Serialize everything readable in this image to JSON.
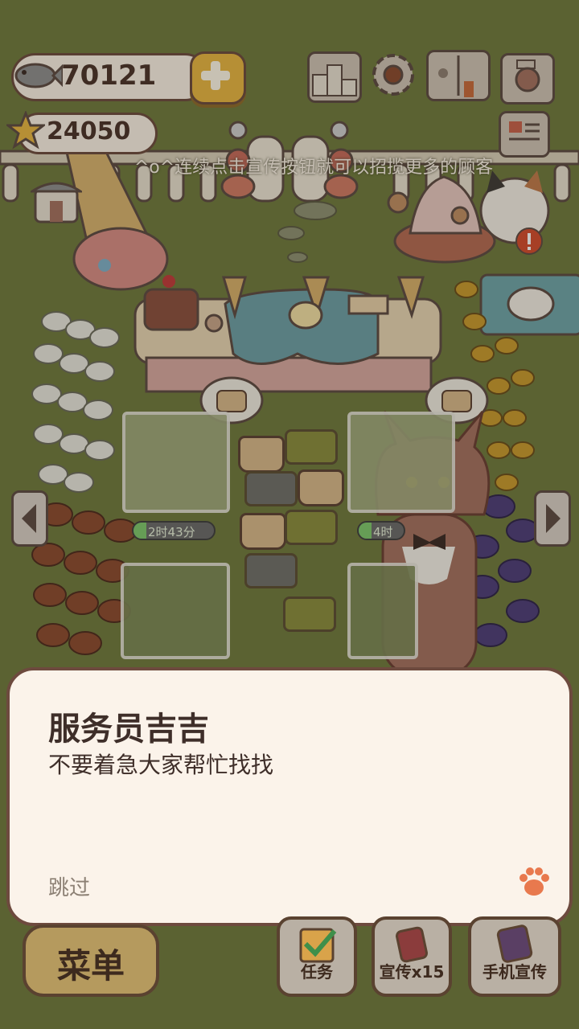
{
  "currency": {
    "fish_count": "70121",
    "star_count": "24050"
  },
  "hint_text": "^o^连续点击宣传按钮就可以招揽更多的顾客",
  "timers": [
    {
      "label": "2时43分"
    },
    {
      "label": "4时"
    }
  ],
  "dialog": {
    "speaker": "服务员吉吉",
    "message": "不要着急大家帮忙找找",
    "skip_label": "跳过"
  },
  "bottom_bar": {
    "menu_label": "菜单",
    "tasks_label": "任务",
    "promote_label": "宣传x15",
    "phone_promote_label": "手机宣传"
  },
  "icons": [
    "fish-icon",
    "plus-icon",
    "star-icon",
    "ranking-icon",
    "settings-gear-icon",
    "recipe-book-icon",
    "camera-icon",
    "newspaper-icon",
    "shop-icon",
    "alert-icon",
    "paw-icon",
    "arrow-left-icon",
    "arrow-right-icon"
  ],
  "colors": {
    "grass": "#6f7a3c",
    "dialog_bg": "#fbf3ea",
    "border_brown": "#6d4a3e",
    "plus_yellow": "#e9b640",
    "paw_orange": "#e8794e"
  }
}
